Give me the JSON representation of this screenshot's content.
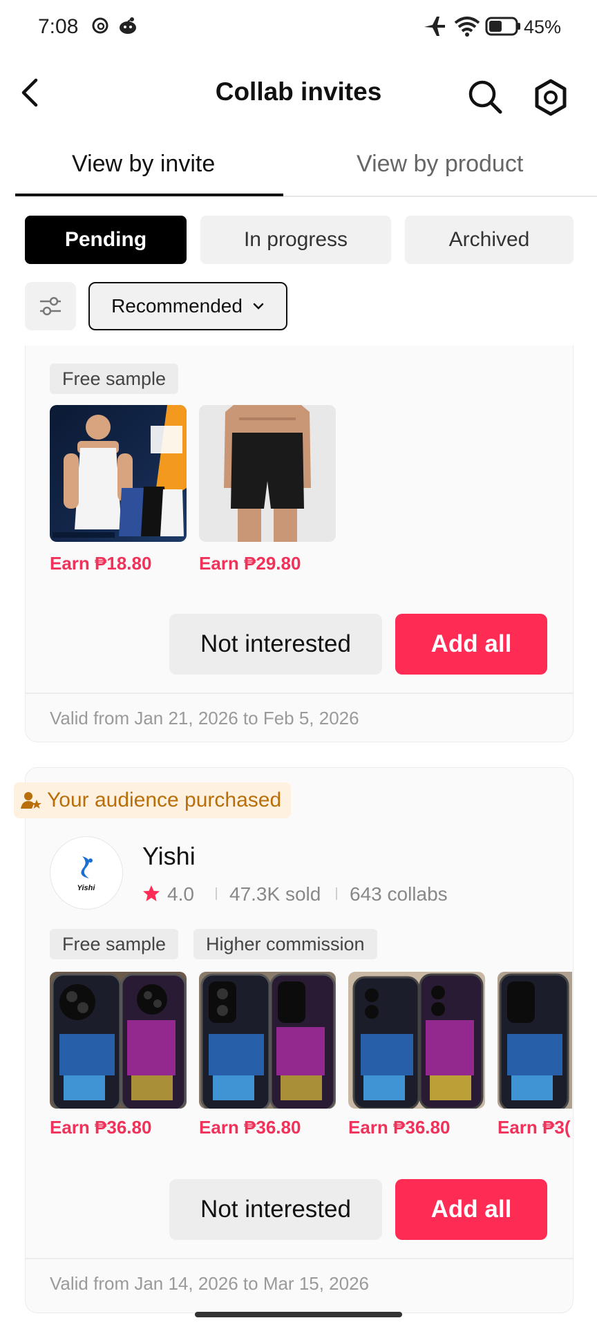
{
  "status_bar": {
    "time": "7:08",
    "battery": "45%"
  },
  "header": {
    "title": "Collab invites"
  },
  "view_tabs": [
    {
      "label": "View by invite",
      "active": true
    },
    {
      "label": "View by product",
      "active": false
    }
  ],
  "status_chips": [
    {
      "label": "Pending",
      "active": true
    },
    {
      "label": "In progress",
      "active": false
    },
    {
      "label": "Archived",
      "active": false
    }
  ],
  "sort": {
    "label": "Recommended"
  },
  "invites": [
    {
      "tags": [
        "Free sample"
      ],
      "products": [
        {
          "earn": "Earn ₱18.80",
          "image": "mens-shaping-vest"
        },
        {
          "earn": "Earn ₱29.80",
          "image": "mens-shaping-shorts"
        }
      ],
      "not_interested_label": "Not interested",
      "add_all_label": "Add all",
      "valid": "Valid from Jan 21, 2026 to Feb 5, 2026"
    },
    {
      "badge": "Your audience purchased",
      "seller": {
        "name": "Yishi",
        "logo_text": "Yishi",
        "rating": "4.0",
        "sold": "47.3K sold",
        "collabs": "643 collabs"
      },
      "tags": [
        "Free sample",
        "Higher commission"
      ],
      "products": [
        {
          "earn": "Earn ₱36.80",
          "image": "phone-case-luck"
        },
        {
          "earn": "Earn ₱36.80",
          "image": "phone-case-luck"
        },
        {
          "earn": "Earn ₱36.80",
          "image": "phone-case-luck"
        },
        {
          "earn": "Earn ₱3(",
          "image": "phone-case-luck"
        }
      ],
      "not_interested_label": "Not interested",
      "add_all_label": "Add all",
      "valid": "Valid from Jan 14, 2026 to Mar 15, 2026"
    }
  ],
  "colors": {
    "accent": "#fe2c55",
    "earn": "#f0325a",
    "badge_bg": "#fff1e0",
    "badge_text": "#b86e0a"
  }
}
